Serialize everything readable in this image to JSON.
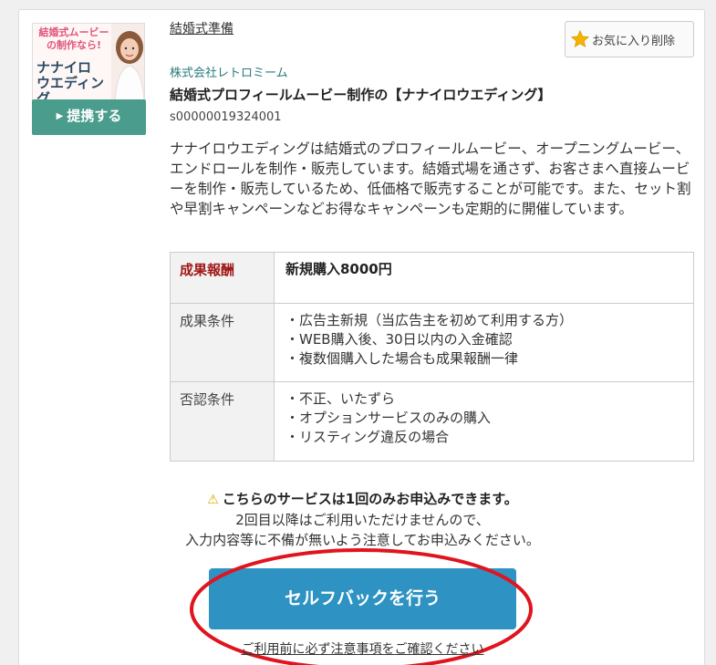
{
  "thumbnail": {
    "catch": "結婚式ムービーの制作なら!",
    "brand_line1": "ナナイロ",
    "brand_line2": "ウエディング"
  },
  "affiliate_button": "提携する",
  "category": "結婚式準備",
  "favorite_button": "お気に入り削除",
  "company": "株式会社レトロミーム",
  "title": "結婚式プロフィールムービー制作の【ナナイロウエディング】",
  "code": "s00000019324001",
  "description": "ナナイロウエディングは結婚式のプロフィールムービー、オープニングムービー、エンドロールを制作・販売しています。結婚式場を通さず、お客さまへ直接ムービーを制作・販売しているため、低価格で販売することが可能です。また、セット割や早割キャンペーンなどお得なキャンペーンも定期的に開催しています。",
  "terms": {
    "reward_label": "成果報酬",
    "reward_value": "新規購入8000円",
    "condition_label": "成果条件",
    "conditions": [
      "・広告主新規（当広告主を初めて利用する方）",
      "・WEB購入後、30日以内の入金確認",
      "・複数個購入した場合も成果報酬一律"
    ],
    "rejection_label": "否認条件",
    "rejections": [
      "・不正、いたずら",
      "・オプションサービスのみの購入",
      "・リスティング違反の場合"
    ]
  },
  "notice": {
    "headline": "こちらのサービスは1回のみお申込みできます。",
    "line1": "2回目以降はご利用いただけませんので、",
    "line2": "入力内容等に不備が無いよう注意してお申込みください。"
  },
  "self_back_button": "セルフバックを行う",
  "confirm_link": "ご利用前に必ず注意事項をご確認ください",
  "colors": {
    "accent_teal": "#4a9c8c",
    "button_blue": "#2e93c2",
    "highlight_red": "#e0141e"
  }
}
